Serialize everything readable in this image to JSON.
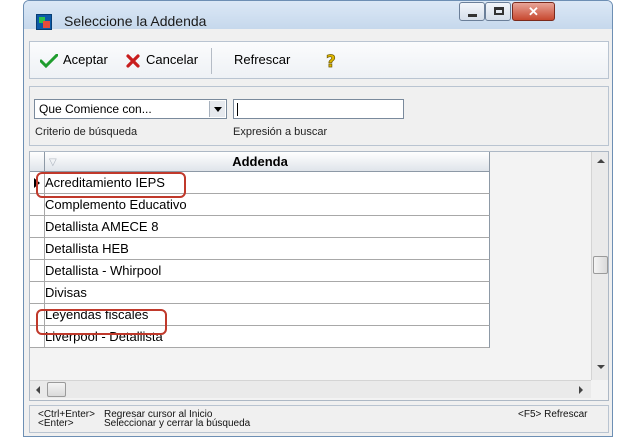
{
  "window": {
    "title": "Seleccione la Addenda"
  },
  "toolbar": {
    "accept_label": "Aceptar",
    "cancel_label": "Cancelar",
    "refresh_label": "Refrescar",
    "icons": {
      "accept": "checkmark-icon",
      "cancel": "x-icon",
      "help": "question-mark-icon"
    }
  },
  "search": {
    "criteria_value": "Que Comience con...",
    "criteria_label": "Criterio de búsqueda",
    "expression_value": "",
    "expression_label": "Expresión a buscar"
  },
  "grid": {
    "column_header": "Addenda",
    "rows": [
      "Acreditamiento IEPS",
      "Complemento Educativo",
      "Detallista AMECE 8",
      "Detallista HEB",
      "Detallista - Whirpool",
      "Divisas",
      "Leyendas fiscales",
      "Liverpool - Detallista"
    ],
    "highlight_color": "#c0392b"
  },
  "status": {
    "line1_key": "<Ctrl+Enter>",
    "line1_text": "Regresar cursor al Inicio",
    "line2_key": "<Enter>",
    "line2_text": "Seleccionar y cerrar la búsqueda",
    "right": "<F5> Refrescar"
  }
}
